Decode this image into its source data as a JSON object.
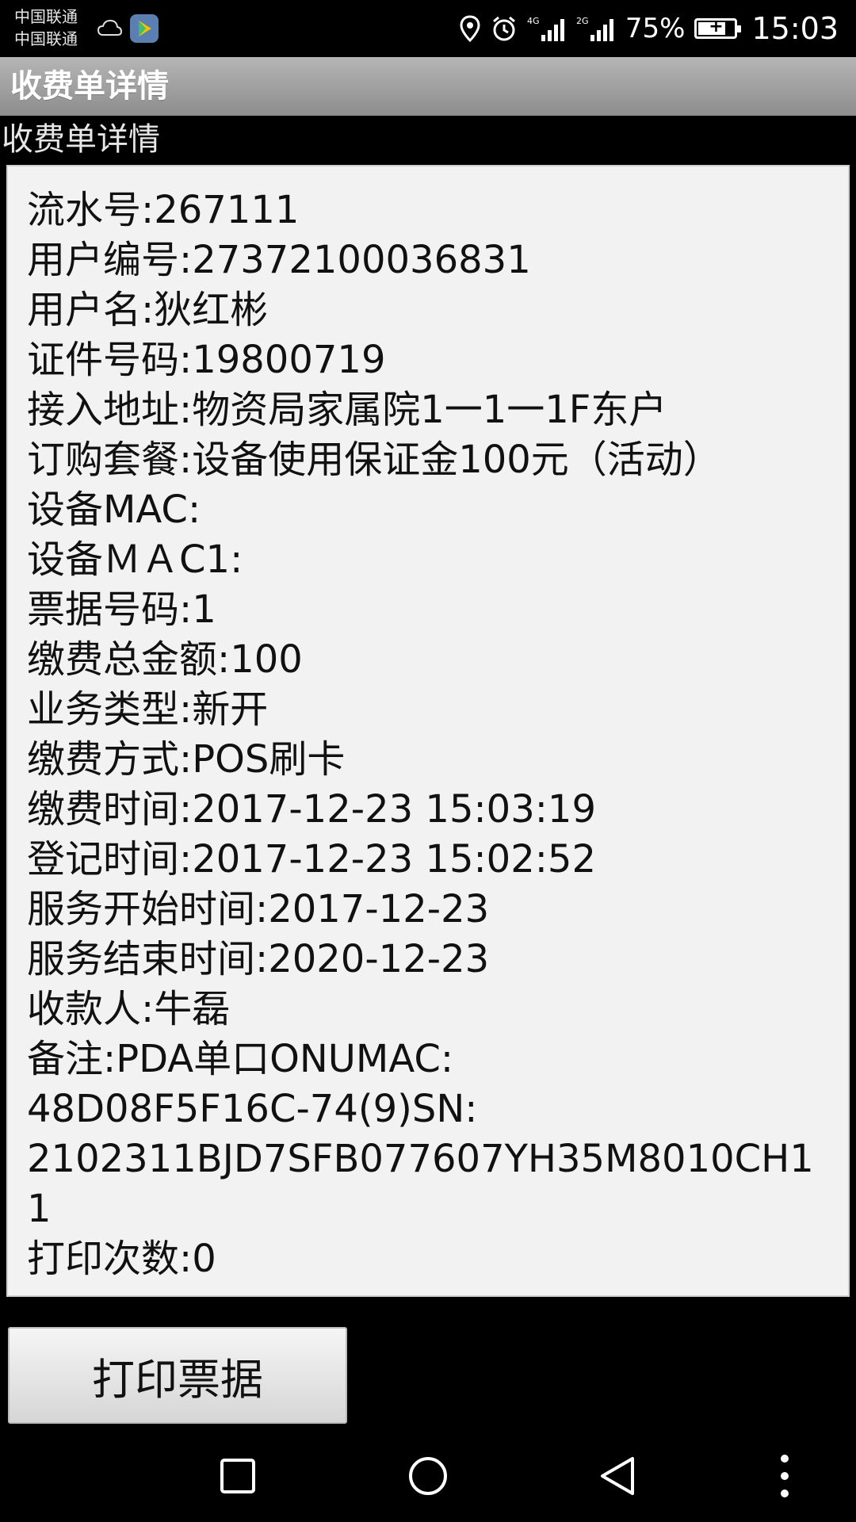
{
  "status_bar": {
    "carrier_1": "中国联通",
    "carrier_2": "中国联通",
    "network_1": "4G",
    "network_2": "2G",
    "battery": "75%",
    "time": "15:03",
    "icons": [
      "location-icon",
      "alarm-icon",
      "signal-icon",
      "battery-icon",
      "weather-icon",
      "play-store-icon"
    ]
  },
  "app": {
    "title": "收费单详情",
    "section_label": "收费单详情"
  },
  "details": [
    {
      "label": "流水号",
      "value": "267111"
    },
    {
      "label": "用户编号",
      "value": "27372100036831"
    },
    {
      "label": "用户名",
      "value": "狄红彬"
    },
    {
      "label": "证件号码",
      "value": "19800719"
    },
    {
      "label": "接入地址",
      "value": "物资局家属院1一1一1F东户"
    },
    {
      "label": "订购套餐",
      "value": "设备使用保证金100元（活动）"
    },
    {
      "label": "设备MAC",
      "value": ""
    },
    {
      "label": "设备ＭＡC1",
      "value": ""
    },
    {
      "label": "票据号码",
      "value": "1"
    },
    {
      "label": "缴费总金额",
      "value": "100"
    },
    {
      "label": "业务类型",
      "value": "新开"
    },
    {
      "label": "缴费方式",
      "value": "POS刷卡"
    },
    {
      "label": "缴费时间",
      "value": "2017-12-23 15:03:19"
    },
    {
      "label": "登记时间",
      "value": "2017-12-23 15:02:52"
    },
    {
      "label": "服务开始时间",
      "value": "2017-12-23"
    },
    {
      "label": "服务结束时间",
      "value": "2020-12-23"
    },
    {
      "label": "收款人",
      "value": "牛磊"
    }
  ],
  "remark": {
    "label": "备注",
    "line_1": "PDA单口ONUMAC:",
    "line_2": "48D08F5F16C-74(9)SN:",
    "line_3": "2102311BJD7SFB077607YH35M8010CH11"
  },
  "print_count": {
    "label": "打印次数",
    "value": "0"
  },
  "print_button": {
    "label": "打印票据"
  },
  "nav_bar": {
    "icons": [
      "recents-icon",
      "home-icon",
      "back-icon",
      "more-icon"
    ]
  },
  "colors": {
    "title_bar": "#a0a0a0",
    "card_background": "#f2f2f2",
    "screen_background": "#000000"
  }
}
